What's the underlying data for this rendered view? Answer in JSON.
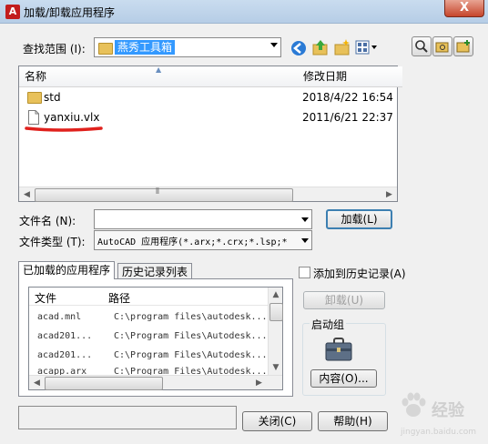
{
  "window": {
    "title": "加载/卸载应用程序",
    "app_icon": "A",
    "close_label": "X"
  },
  "lookin": {
    "label": "查找范围 (I):",
    "value": "燕秀工具箱"
  },
  "filelist": {
    "columns": [
      "名称",
      "修改日期"
    ],
    "rows": [
      {
        "name": "std",
        "date": "2018/4/22 16:54",
        "icon": "folder-icon"
      },
      {
        "name": "yanxiu.vlx",
        "date": "2011/6/21 22:37",
        "icon": "file-icon"
      }
    ]
  },
  "filename": {
    "label": "文件名 (N):",
    "value": ""
  },
  "filetype": {
    "label": "文件类型 (T):",
    "value": "AutoCAD 应用程序(*.arx;*.crx;*.lsp;*"
  },
  "load_button": "加载(L)",
  "tabs": [
    "已加载的应用程序",
    "历史记录列表"
  ],
  "loaded": {
    "columns": [
      "文件",
      "路径"
    ],
    "rows": [
      {
        "file": "acad.mnl",
        "path": "C:\\program files\\autodesk..."
      },
      {
        "file": "acad201...",
        "path": "C:\\Program Files\\Autodesk..."
      },
      {
        "file": "acad201...",
        "path": "C:\\Program Files\\Autodesk..."
      },
      {
        "file": "acapp.arx",
        "path": "C:\\Program Files\\Autodesk..."
      }
    ]
  },
  "add_history": {
    "label": "添加到历史记录(A)",
    "checked": false
  },
  "unload_button": "卸载(U)",
  "startup": {
    "group_label": "启动组",
    "contents_button": "内容(O)..."
  },
  "close_button": "关闭(C)",
  "help_button": "帮助(H)",
  "watermark": {
    "text": "经验",
    "sub": "jingyan.baidu.com"
  },
  "colors": {
    "annotation_underline": "#e0211d",
    "selected_folder": "#3399ff"
  }
}
